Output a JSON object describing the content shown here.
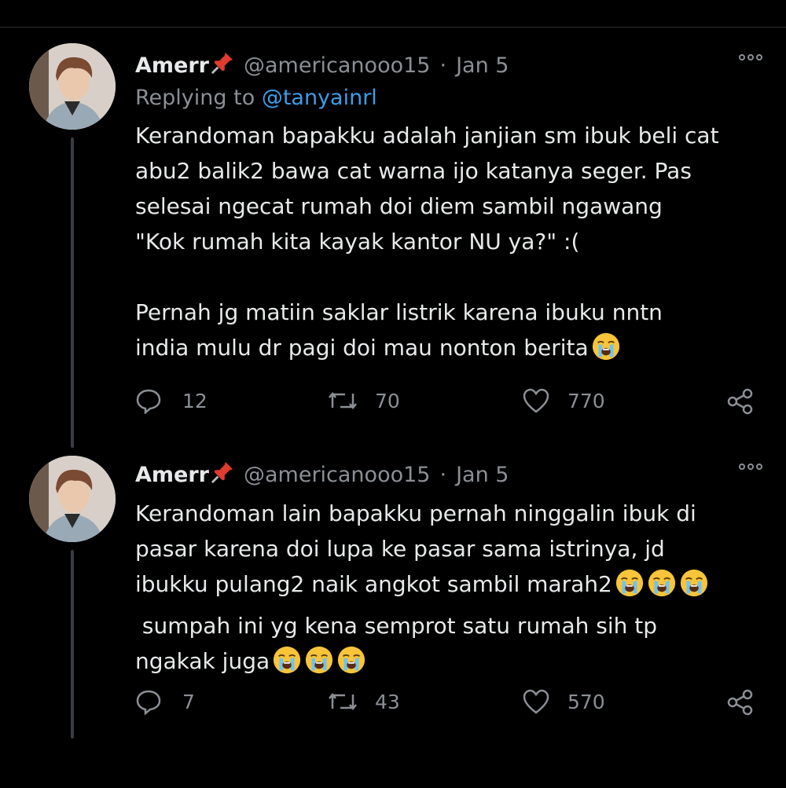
{
  "tweets": [
    {
      "name": "Amerr",
      "handle": "@americanooo15",
      "separator": "·",
      "date": "Jan 5",
      "replying_prefix": "Replying to ",
      "replying_to": "@tanyainrl",
      "body_lines": [
        "Kerandoman bapakku adalah janjian sm ibuk beli cat",
        "abu2 balik2 bawa cat warna ijo katanya seger. Pas",
        "selesai ngecat rumah doi diem sambil ngawang",
        "\"Kok rumah kita kayak kantor NU ya?\" :(",
        "",
        "Pernah jg matiin saklar listrik karena ibuku nntn",
        "india mulu dr pagi doi mau nonton berita"
      ],
      "replies": "12",
      "retweets": "70",
      "likes": "770"
    },
    {
      "name": "Amerr",
      "handle": "@americanooo15",
      "separator": "·",
      "date": "Jan 5",
      "body_lines": [
        "Kerandoman lain bapakku pernah ninggalin ibuk di",
        "pasar karena doi lupa ke pasar sama istrinya, jd",
        "ibukku pulang2 naik angkot sambil marah2",
        " sumpah ini yg kena semprot satu rumah sih tp",
        "ngakak juga"
      ],
      "replies": "7",
      "retweets": "43",
      "likes": "570"
    }
  ],
  "icons": {
    "pin": "pushpin-icon",
    "emoji": "loudly-crying-face-icon",
    "reply": "reply-icon",
    "retweet": "retweet-icon",
    "like": "heart-icon",
    "share": "share-icon",
    "more": "more-options-icon"
  },
  "colors": {
    "background": "#000000",
    "text": "#e7e9ea",
    "secondary": "#8b8f95",
    "link": "#3b9ee9"
  }
}
